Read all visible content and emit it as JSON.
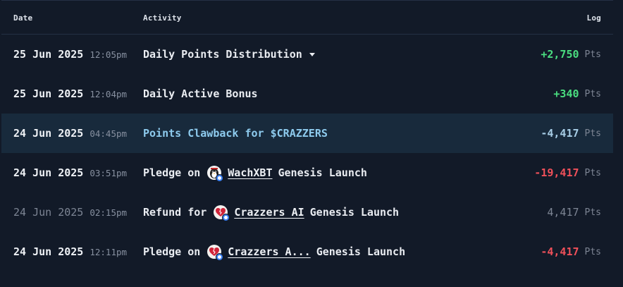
{
  "table": {
    "headers": {
      "date": "Date",
      "activity": "Activity",
      "log": "Log"
    },
    "unit": "Pts",
    "rows": [
      {
        "date": "25 Jun 2025",
        "time": "12:05pm",
        "activity": "Daily Points Distribution",
        "amount": "+2,750"
      },
      {
        "date": "25 Jun 2025",
        "time": "12:04pm",
        "activity": "Daily Active Bonus",
        "amount": "+340"
      },
      {
        "date": "24 Jun 2025",
        "time": "04:45pm",
        "activity": "Points Clawback for $CRAZZERS",
        "amount": "-4,417"
      },
      {
        "date": "24 Jun 2025",
        "time": "03:51pm",
        "activity_prefix": "Pledge on",
        "token": "WachXBT",
        "activity_suffix": "Genesis Launch",
        "amount": "-19,417"
      },
      {
        "date": "24 Jun 2025",
        "time": "02:15pm",
        "activity_prefix": "Refund for",
        "token": "Crazzers AI",
        "activity_suffix": "Genesis Launch",
        "amount": "4,417"
      },
      {
        "date": "24 Jun 2025",
        "time": "12:11pm",
        "activity_prefix": "Pledge on",
        "token": "Crazzers A...",
        "activity_suffix": "Genesis Launch",
        "amount": "-4,417"
      }
    ]
  },
  "colors": {
    "background": "#121a28",
    "positive": "#4ade80",
    "negative": "#f0505a",
    "highlight_row": "#182a3c",
    "link_blue": "#8ecbee"
  },
  "icons": {
    "dropdown": "chevron-down-icon",
    "wach_avatar": "penguin-avatar-icon",
    "crazzers_avatar": "broken-heart-avatar-icon",
    "verified": "verified-badge-icon"
  }
}
